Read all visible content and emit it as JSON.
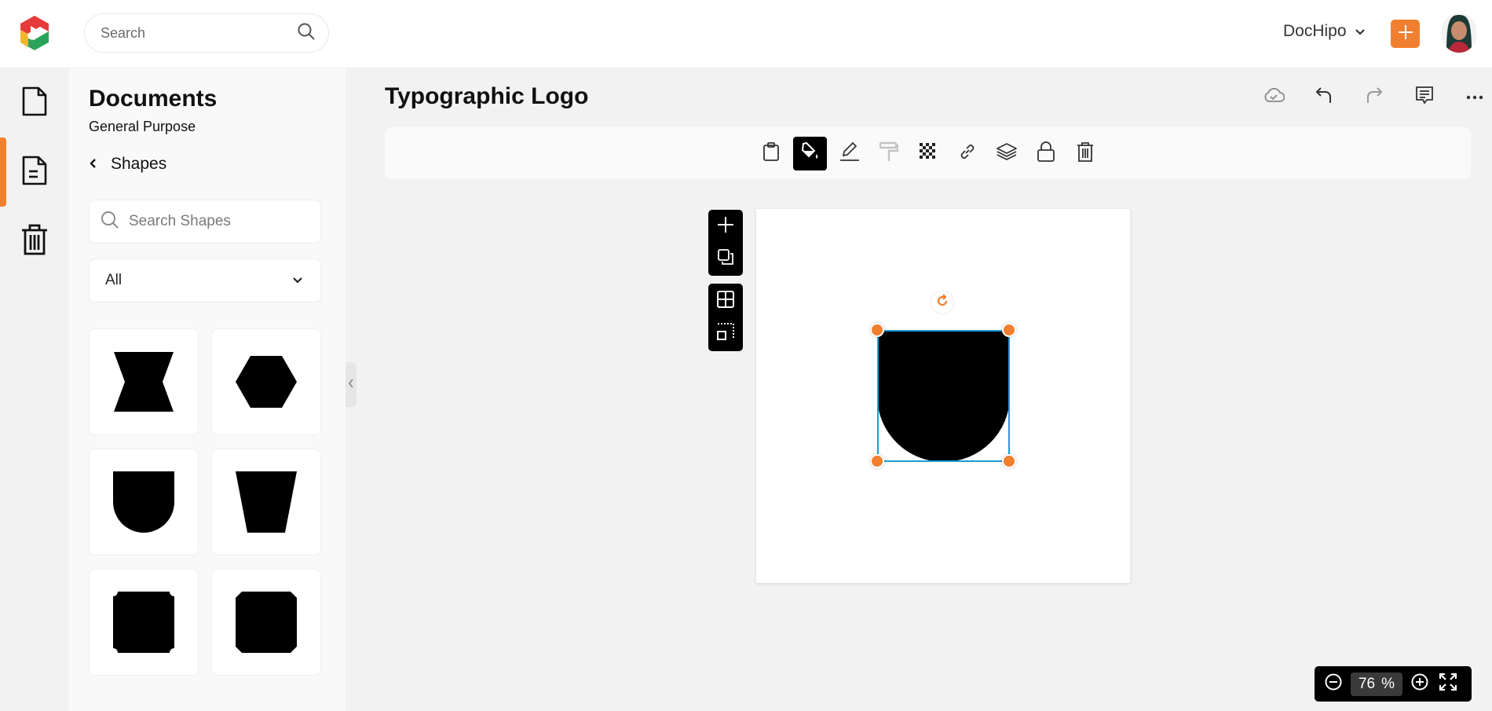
{
  "header": {
    "logo_icon": "dochipo-logo-icon",
    "search_placeholder": "Search",
    "workspace_label": "DocHipo",
    "add_icon": "plus-icon",
    "avatar_alt": "user-avatar"
  },
  "rail": {
    "items": [
      {
        "name": "documents",
        "icon": "file-icon",
        "active": false
      },
      {
        "name": "templates",
        "icon": "file-text-icon",
        "active": true
      },
      {
        "name": "trash",
        "icon": "trash-icon",
        "active": false
      }
    ]
  },
  "panel": {
    "title": "Documents",
    "subtitle": "General Purpose",
    "back_label": "Shapes",
    "search_placeholder": "Search Shapes",
    "filter_value": "All",
    "shapes": [
      "hourglass",
      "hexagon",
      "shield-rounded-bottom",
      "trapezoid-inverted",
      "square-inset-rounded-corners",
      "octagon-square"
    ]
  },
  "editor": {
    "document_title": "Typographic Logo",
    "top_actions": [
      "cloud-saved",
      "undo",
      "redo",
      "comments",
      "more"
    ],
    "tools": [
      "paste",
      "fill-color",
      "border-color",
      "format-painter",
      "transparency",
      "link",
      "layers",
      "lock",
      "delete"
    ],
    "active_tool": "fill-color",
    "float_tools_1": [
      "add-page",
      "duplicate-page"
    ],
    "float_tools_2": [
      "grid",
      "select-area"
    ],
    "accent_color": "#f07f2f",
    "selection_color": "#1e9bd7"
  },
  "zoom": {
    "value": "76",
    "unit": "%"
  }
}
